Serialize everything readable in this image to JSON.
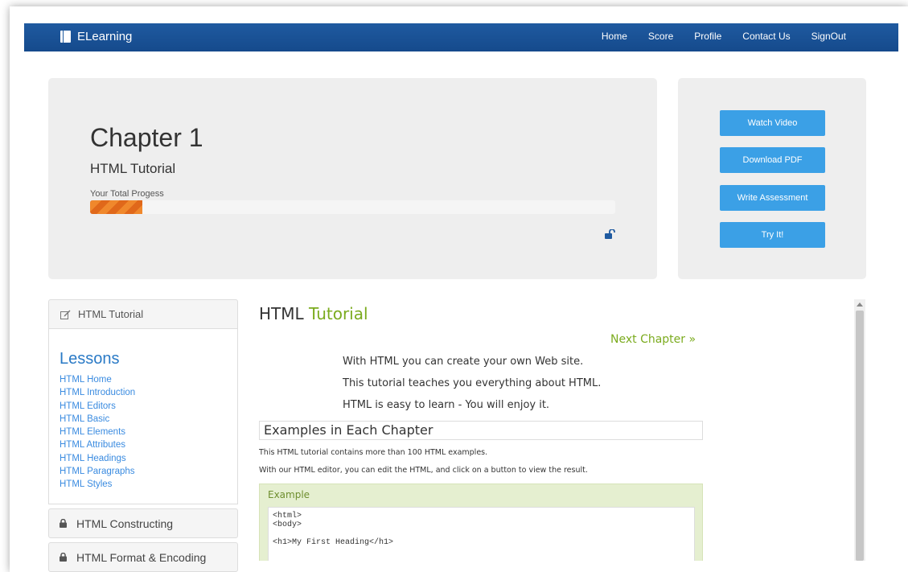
{
  "navbar": {
    "brand": "ELearning",
    "links": [
      "Home",
      "Score",
      "Profile",
      "Contact Us",
      "SignOut"
    ]
  },
  "hero": {
    "chapter_title": "Chapter 1",
    "chapter_subtitle": "HTML Tutorial",
    "progress_label": "Your Total Progess",
    "progress_fraction": 0.1
  },
  "actions": {
    "watch_video": "Watch Video",
    "download_pdf": "Download PDF",
    "write_assessment": "Write Assessment",
    "try_it": "Try It!"
  },
  "sidebar": {
    "current_module": "HTML Tutorial",
    "lessons_title": "Lessons",
    "lessons": [
      "HTML Home",
      "HTML Introduction",
      "HTML Editors",
      "HTML Basic",
      "HTML Elements",
      "HTML Attributes",
      "HTML Headings",
      "HTML Paragraphs",
      "HTML Styles"
    ],
    "locked_modules": [
      "HTML Constructing",
      "HTML Format & Encoding"
    ]
  },
  "content": {
    "title_main": "HTML",
    "title_accent": "Tutorial",
    "next_chapter": "Next Chapter »",
    "intro": [
      "With HTML you can create your own Web site.",
      "This tutorial teaches you everything about HTML.",
      "HTML is easy to learn - You will enjoy it."
    ],
    "section_title": "Examples in Each Chapter",
    "section_text_1": "This HTML tutorial contains more than 100 HTML examples.",
    "section_text_2": "With our HTML editor, you can edit the HTML, and click on a button to view the result.",
    "example_label": "Example",
    "code": "<html>\n<body>\n\n<h1>My First Heading</h1>"
  },
  "colors": {
    "navbar": "#1f5aa0",
    "action_button": "#3ba0e6",
    "accent_green": "#7bab1e",
    "progress": "#f0882c"
  }
}
